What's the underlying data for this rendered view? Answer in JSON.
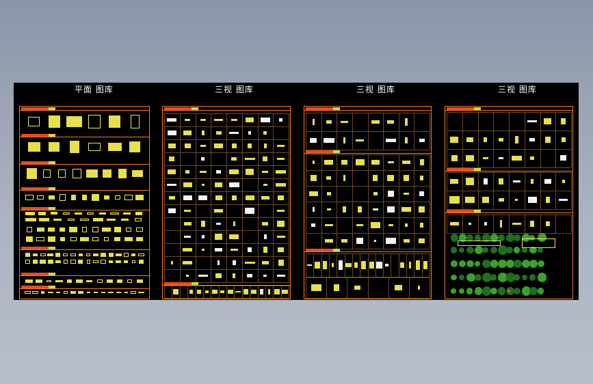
{
  "sheets": [
    {
      "title": "平面 图库"
    },
    {
      "title": "三视 图库"
    },
    {
      "title": "三视 图库"
    },
    {
      "title": "三视 图库"
    }
  ],
  "colors": {
    "background": "#000000",
    "frame": "#ff7a1a",
    "symbol": "#e6e04a",
    "tree": "#3aa02e",
    "tag": "#e84c1a"
  }
}
